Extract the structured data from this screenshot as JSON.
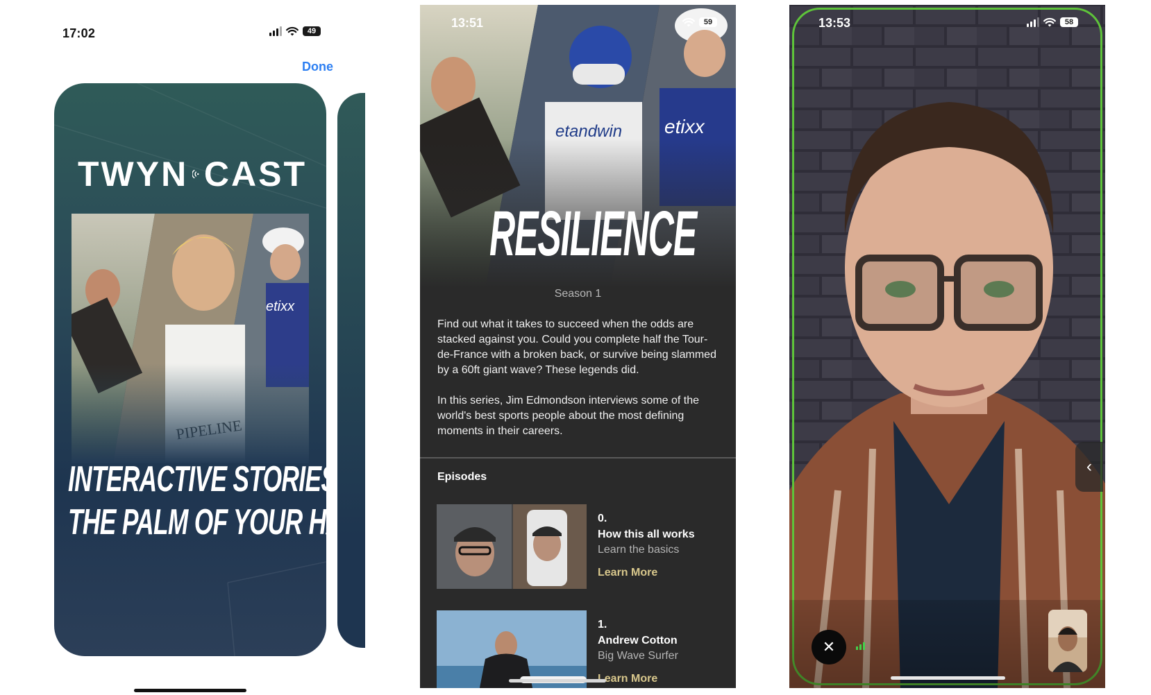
{
  "screen1": {
    "time": "17:02",
    "battery": "49",
    "done_label": "Done",
    "logo_left": "TWYN",
    "logo_right": "CAST",
    "headline_line1": "INTERACTIVE STORIES IN",
    "headline_line2": "THE PALM OF YOUR HAND"
  },
  "screen2": {
    "time": "13:51",
    "battery": "59",
    "title": "RESILIENCE",
    "season": "Season 1",
    "description_1": "Find out what it takes to succeed when the odds are stacked against you. Could you complete half the Tour-de-France with a broken back, or survive being slammed by a 60ft giant wave? These legends did.",
    "description_2": "In this series, Jim Edmondson interviews some of the world's best sports people about the most defining moments in their careers.",
    "episodes_heading": "Episodes",
    "episodes": [
      {
        "number": "0.",
        "title": "How this all works",
        "subtitle": "Learn the basics",
        "action": "Learn More"
      },
      {
        "number": "1.",
        "title": "Andrew Cotton",
        "subtitle": "Big Wave Surfer",
        "action": "Learn More"
      }
    ]
  },
  "screen3": {
    "time": "13:53",
    "battery": "58",
    "close_symbol": "✕",
    "side_tab_symbol": "‹"
  },
  "colors": {
    "accent_blue": "#2d7ff2",
    "learn_more": "#d8c78c",
    "frame_green": "#5ec43a",
    "card_teal": "#2f5b58",
    "dark_panel": "#2a2a2a"
  }
}
